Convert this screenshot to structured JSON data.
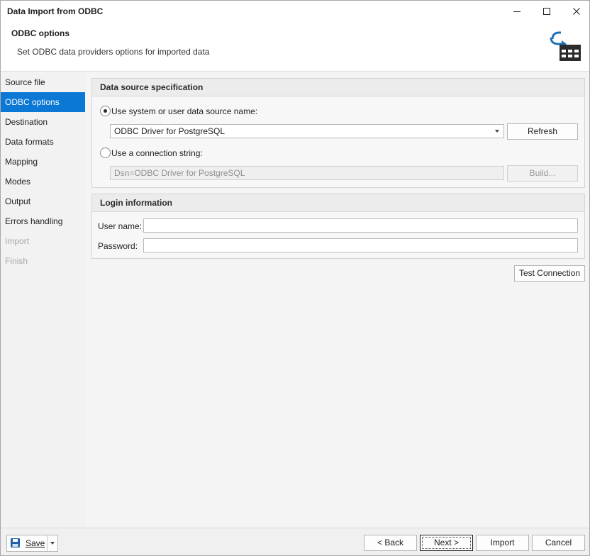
{
  "window": {
    "title": "Data Import from ODBC",
    "controls": [
      "minimize-icon",
      "maximize-icon",
      "close-icon"
    ]
  },
  "header": {
    "title": "ODBC options",
    "description": "Set ODBC data providers options for imported data",
    "icon": "import-table-icon",
    "accent": "#1e6fb8"
  },
  "sidebar": {
    "active_color": "#0a78d4",
    "items": [
      {
        "label": "Source file",
        "state": "normal"
      },
      {
        "label": "ODBC options",
        "state": "active"
      },
      {
        "label": "Destination",
        "state": "normal"
      },
      {
        "label": "Data formats",
        "state": "normal"
      },
      {
        "label": "Mapping",
        "state": "normal"
      },
      {
        "label": "Modes",
        "state": "normal"
      },
      {
        "label": "Output",
        "state": "normal"
      },
      {
        "label": "Errors handling",
        "state": "normal"
      },
      {
        "label": "Import",
        "state": "disabled"
      },
      {
        "label": "Finish",
        "state": "disabled"
      }
    ]
  },
  "data_source": {
    "heading": "Data source specification",
    "dsn_radio_label": "Use system or user data source name:",
    "dsn_selected": true,
    "dsn_value": "ODBC Driver for PostgreSQL",
    "refresh_label": "Refresh",
    "conn_radio_label": "Use a connection string:",
    "conn_value": "Dsn=ODBC Driver for PostgreSQL",
    "build_label": "Build..."
  },
  "login": {
    "heading": "Login information",
    "user_label": "User name:",
    "user_value": "",
    "password_label": "Password:",
    "password_value": ""
  },
  "test_connection_label": "Test Connection",
  "footer": {
    "save_label": "Save",
    "back_label": "< Back",
    "next_label": "Next >",
    "import_label": "Import",
    "cancel_label": "Cancel"
  }
}
